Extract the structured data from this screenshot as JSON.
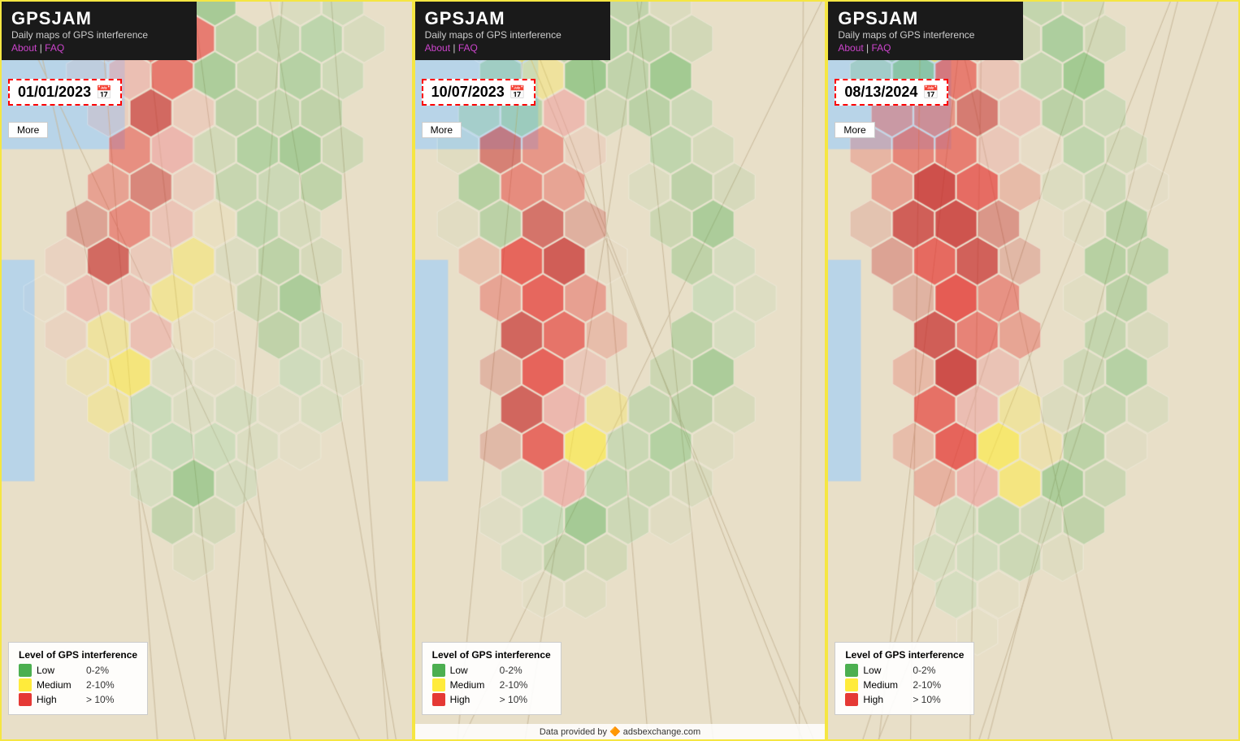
{
  "page": {
    "background": "#f5e642",
    "footer_text": "Data provided by",
    "footer_provider": "adsbexchange.com"
  },
  "panels": [
    {
      "id": "panel1",
      "title": "GPSJAM",
      "subtitle": "Daily maps of GPS interference",
      "about_label": "About",
      "faq_label": "FAQ",
      "date": "01/01/2023",
      "more_label": "More",
      "legend": {
        "title": "Level of GPS interference",
        "items": [
          {
            "color": "#4caf50",
            "label": "Low",
            "range": "0-2%"
          },
          {
            "color": "#ffeb3b",
            "label": "Medium",
            "range": "2-10%"
          },
          {
            "color": "#e53935",
            "label": "High",
            "range": "> 10%"
          }
        ]
      }
    },
    {
      "id": "panel2",
      "title": "GPSJAM",
      "subtitle": "Daily maps of GPS interference",
      "about_label": "About",
      "faq_label": "FAQ",
      "date": "10/07/2023",
      "more_label": "More",
      "legend": {
        "title": "Level of GPS interference",
        "items": [
          {
            "color": "#4caf50",
            "label": "Low",
            "range": "0-2%"
          },
          {
            "color": "#ffeb3b",
            "label": "Medium",
            "range": "2-10%"
          },
          {
            "color": "#e53935",
            "label": "High",
            "range": "> 10%"
          }
        ]
      }
    },
    {
      "id": "panel3",
      "title": "GPSJAM",
      "subtitle": "Daily maps of GPS interference",
      "about_label": "About",
      "faq_label": "FAQ",
      "date": "08/13/2024",
      "more_label": "More",
      "legend": {
        "title": "Level of GPS interference",
        "items": [
          {
            "color": "#4caf50",
            "label": "Low",
            "range": "0-2%"
          },
          {
            "color": "#ffeb3b",
            "label": "Medium",
            "range": "2-10%"
          },
          {
            "color": "#e53935",
            "label": "High",
            "range": "> 10%"
          }
        ]
      }
    }
  ],
  "colors": {
    "high": "#e53935",
    "high_light": "#ef9a9a",
    "medium": "#ffeb3b",
    "low": "#4caf50",
    "low_light": "#a5d6a7",
    "water": "#b3d9f5",
    "land": "#f0ead6",
    "border": "#999"
  }
}
